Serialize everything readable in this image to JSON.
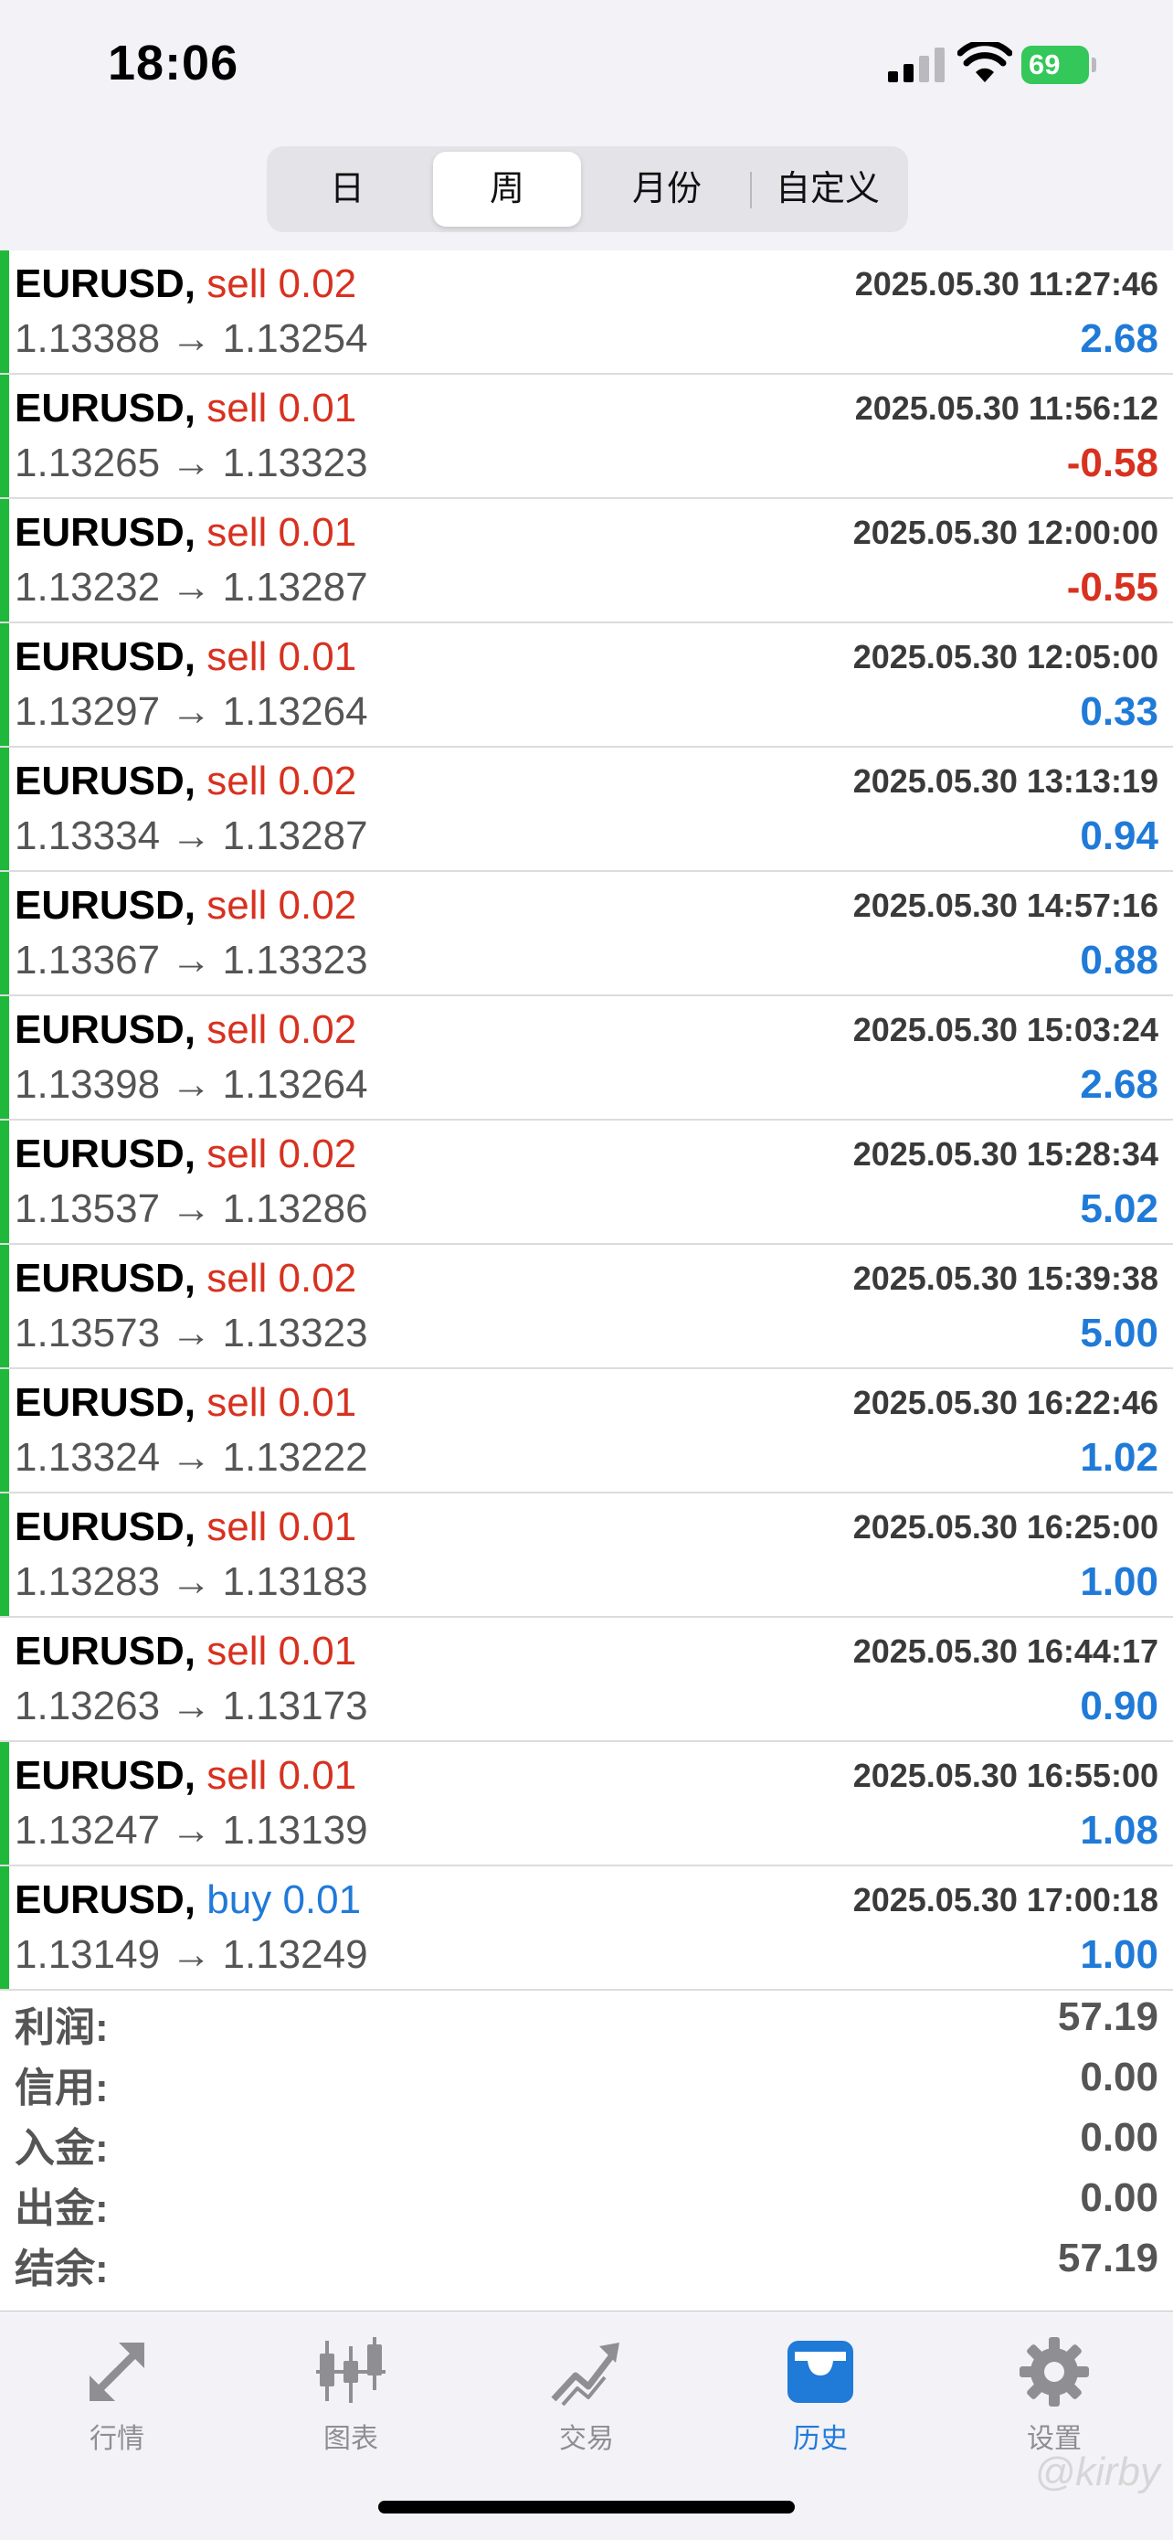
{
  "status_bar": {
    "time": "18:06",
    "battery": "69",
    "icons": [
      "cellular-signal-icon",
      "wifi-icon",
      "battery-charging-icon"
    ]
  },
  "period_tabs": {
    "items": [
      "日",
      "周",
      "月份",
      "自定义"
    ],
    "selected": "周"
  },
  "deals": [
    {
      "symbol": "EURUSD,",
      "side": "sell",
      "volume": "0.02",
      "datetime": "2025.05.30 11:27:46",
      "prices": "1.13388 → 1.13254",
      "profit": "2.68"
    },
    {
      "symbol": "EURUSD,",
      "side": "sell",
      "volume": "0.01",
      "datetime": "2025.05.30 11:56:12",
      "prices": "1.13265 → 1.13323",
      "profit": "-0.58"
    },
    {
      "symbol": "EURUSD,",
      "side": "sell",
      "volume": "0.01",
      "datetime": "2025.05.30 12:00:00",
      "prices": "1.13232 → 1.13287",
      "profit": "-0.55"
    },
    {
      "symbol": "EURUSD,",
      "side": "sell",
      "volume": "0.01",
      "datetime": "2025.05.30 12:05:00",
      "prices": "1.13297 → 1.13264",
      "profit": "0.33"
    },
    {
      "symbol": "EURUSD,",
      "side": "sell",
      "volume": "0.02",
      "datetime": "2025.05.30 13:13:19",
      "prices": "1.13334 → 1.13287",
      "profit": "0.94"
    },
    {
      "symbol": "EURUSD,",
      "side": "sell",
      "volume": "0.02",
      "datetime": "2025.05.30 14:57:16",
      "prices": "1.13367 → 1.13323",
      "profit": "0.88"
    },
    {
      "symbol": "EURUSD,",
      "side": "sell",
      "volume": "0.02",
      "datetime": "2025.05.30 15:03:24",
      "prices": "1.13398 → 1.13264",
      "profit": "2.68"
    },
    {
      "symbol": "EURUSD,",
      "side": "sell",
      "volume": "0.02",
      "datetime": "2025.05.30 15:28:34",
      "prices": "1.13537 → 1.13286",
      "profit": "5.02"
    },
    {
      "symbol": "EURUSD,",
      "side": "sell",
      "volume": "0.02",
      "datetime": "2025.05.30 15:39:38",
      "prices": "1.13573 → 1.13323",
      "profit": "5.00"
    },
    {
      "symbol": "EURUSD,",
      "side": "sell",
      "volume": "0.01",
      "datetime": "2025.05.30 16:22:46",
      "prices": "1.13324 → 1.13222",
      "profit": "1.02"
    },
    {
      "symbol": "EURUSD,",
      "side": "sell",
      "volume": "0.01",
      "datetime": "2025.05.30 16:25:00",
      "prices": "1.13283 → 1.13183",
      "profit": "1.00"
    },
    {
      "symbol": "EURUSD,",
      "side": "sell",
      "volume": "0.01",
      "datetime": "2025.05.30 16:44:17",
      "prices": "1.13263 → 1.13173",
      "profit": "0.90"
    },
    {
      "symbol": "EURUSD,",
      "side": "sell",
      "volume": "0.01",
      "datetime": "2025.05.30 16:55:00",
      "prices": "1.13247 → 1.13139",
      "profit": "1.08"
    },
    {
      "symbol": "EURUSD,",
      "side": "buy",
      "volume": "0.01",
      "datetime": "2025.05.30 17:00:18",
      "prices": "1.13149 → 1.13249",
      "profit": "1.00"
    }
  ],
  "summary": [
    {
      "label": "利润:",
      "value": "57.19"
    },
    {
      "label": "信用:",
      "value": "0.00"
    },
    {
      "label": "入金:",
      "value": "0.00"
    },
    {
      "label": "出金:",
      "value": "0.00"
    },
    {
      "label": "结余:",
      "value": "57.19"
    }
  ],
  "tab_bar": {
    "items": [
      {
        "label": "行情",
        "icon": "quotes-arrows-icon"
      },
      {
        "label": "图表",
        "icon": "candlestick-chart-icon"
      },
      {
        "label": "交易",
        "icon": "trade-trend-icon"
      },
      {
        "label": "历史",
        "icon": "history-inbox-icon"
      },
      {
        "label": "设置",
        "icon": "gear-icon"
      }
    ],
    "active": "历史"
  },
  "watermark": "@kirby",
  "colors": {
    "sell": "#d8311f",
    "buy": "#1f7ad8",
    "profit_positive": "#1f7ad8",
    "profit_negative": "#d8311f",
    "row_accent": "#1fb83a",
    "tab_active": "#1f7ad8",
    "tab_inactive": "#8e8e93"
  }
}
